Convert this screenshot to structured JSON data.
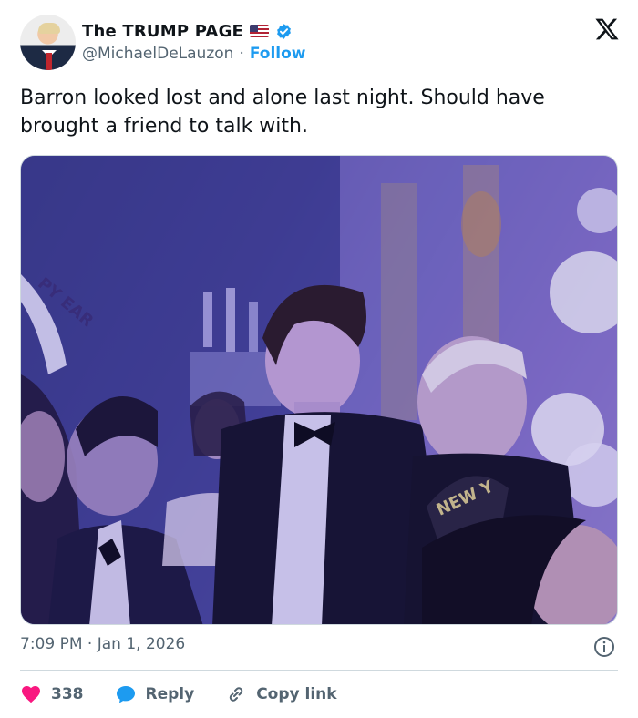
{
  "tweet": {
    "display_name": "The TRUMP PAGE",
    "handle": "@MichaelDeLauzon",
    "separator": "·",
    "follow_label": "Follow",
    "text": "Barron looked lost and alone last night. Should have brought a friend to talk with.",
    "time": "7:09 PM",
    "date_separator": "·",
    "date": "Jan 1, 2026"
  },
  "media": {
    "sign_text_left": "PY EAR",
    "hat_text": "NEW Y"
  },
  "actions": {
    "likes_count": "338",
    "reply_label": "Reply",
    "copy_link_label": "Copy link"
  },
  "icons": {
    "brand": "x-logo-icon",
    "flag": "us-flag-icon",
    "verified": "verified-badge-icon",
    "info": "info-icon",
    "like": "heart-icon",
    "reply": "speech-bubble-icon",
    "copy": "link-icon"
  },
  "colors": {
    "accent": "#1d9bf0",
    "like": "#f91880",
    "muted": "#536471",
    "text": "#0f1419"
  }
}
